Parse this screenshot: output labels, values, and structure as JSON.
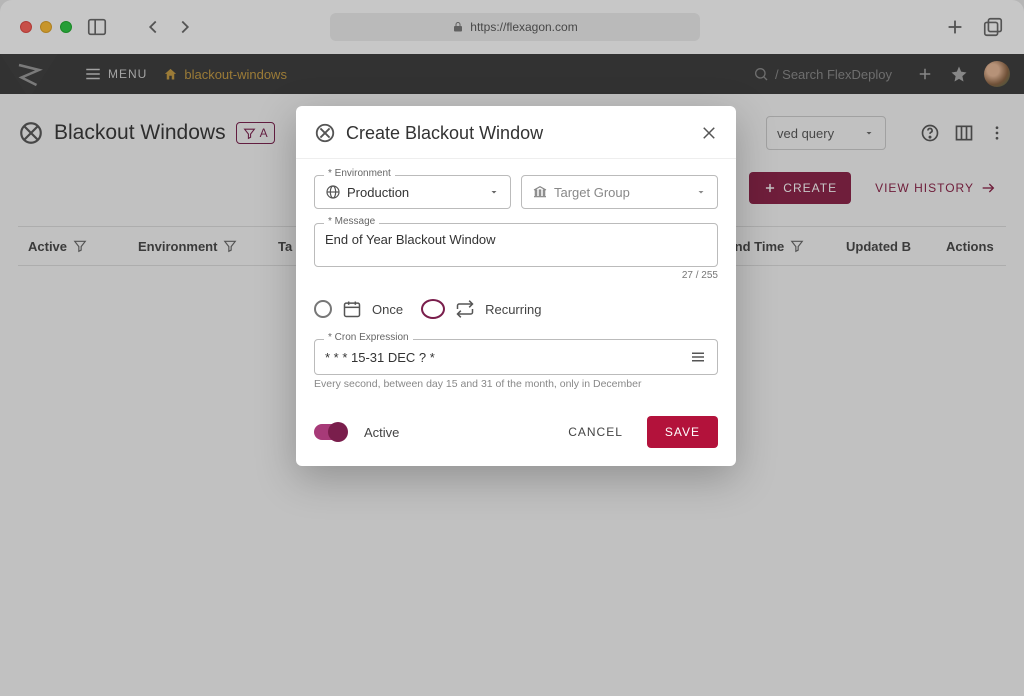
{
  "browser": {
    "url": "https://flexagon.com"
  },
  "appbar": {
    "menu": "MENU",
    "breadcrumb": "blackout-windows",
    "search_placeholder": "/ Search FlexDeploy"
  },
  "page": {
    "title": "Blackout Windows",
    "filter_chip": "A",
    "saved_query": "ved query",
    "create": "CREATE",
    "view_history": "VIEW HISTORY",
    "columns": {
      "active": "Active",
      "environment": "Environment",
      "target": "Ta",
      "end_time": "End Time",
      "updated_by": "Updated B",
      "actions": "Actions"
    }
  },
  "modal": {
    "title": "Create Blackout Window",
    "env_label": "* Environment",
    "env_value": "Production",
    "tg_placeholder": "Target Group",
    "msg_label": "* Message",
    "msg_value": "End of Year Blackout Window",
    "msg_counter": "27 / 255",
    "once": "Once",
    "recurring": "Recurring",
    "cron_label": "* Cron Expression",
    "cron_value": "* * * 15-31 DEC ? *",
    "cron_helper": "Every second, between day 15 and 31 of the month, only in December",
    "active": "Active",
    "cancel": "CANCEL",
    "save": "SAVE"
  }
}
